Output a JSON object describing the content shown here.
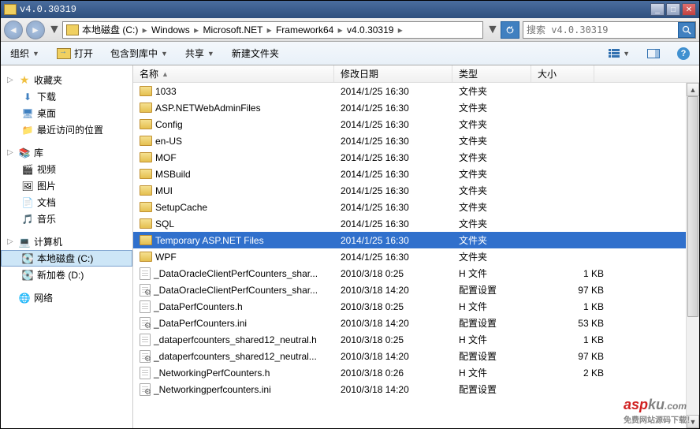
{
  "title": "v4.0.30319",
  "breadcrumb": [
    "本地磁盘 (C:)",
    "Windows",
    "Microsoft.NET",
    "Framework64",
    "v4.0.30319"
  ],
  "search_placeholder": "搜索 v4.0.30319",
  "toolbar": {
    "org": "组织",
    "open": "打开",
    "include": "包含到库中",
    "share": "共享",
    "newfolder": "新建文件夹"
  },
  "sidebar": {
    "favorites": {
      "label": "收藏夹",
      "items": [
        "下载",
        "桌面",
        "最近访问的位置"
      ]
    },
    "library": {
      "label": "库",
      "items": [
        "视频",
        "图片",
        "文档",
        "音乐"
      ]
    },
    "computer": {
      "label": "计算机",
      "items": [
        "本地磁盘 (C:)",
        "新加卷 (D:)"
      ]
    },
    "network": {
      "label": "网络"
    }
  },
  "columns": {
    "name": "名称",
    "date": "修改日期",
    "type": "类型",
    "size": "大小"
  },
  "selected_index": 9,
  "files": [
    {
      "icon": "folder",
      "name": "1033",
      "date": "2014/1/25 16:30",
      "type": "文件夹",
      "size": ""
    },
    {
      "icon": "folder",
      "name": "ASP.NETWebAdminFiles",
      "date": "2014/1/25 16:30",
      "type": "文件夹",
      "size": ""
    },
    {
      "icon": "folder",
      "name": "Config",
      "date": "2014/1/25 16:30",
      "type": "文件夹",
      "size": ""
    },
    {
      "icon": "folder",
      "name": "en-US",
      "date": "2014/1/25 16:30",
      "type": "文件夹",
      "size": ""
    },
    {
      "icon": "folder",
      "name": "MOF",
      "date": "2014/1/25 16:30",
      "type": "文件夹",
      "size": ""
    },
    {
      "icon": "folder",
      "name": "MSBuild",
      "date": "2014/1/25 16:30",
      "type": "文件夹",
      "size": ""
    },
    {
      "icon": "folder",
      "name": "MUI",
      "date": "2014/1/25 16:30",
      "type": "文件夹",
      "size": ""
    },
    {
      "icon": "folder",
      "name": "SetupCache",
      "date": "2014/1/25 16:30",
      "type": "文件夹",
      "size": ""
    },
    {
      "icon": "folder",
      "name": "SQL",
      "date": "2014/1/25 16:30",
      "type": "文件夹",
      "size": ""
    },
    {
      "icon": "folder",
      "name": "Temporary ASP.NET Files",
      "date": "2014/1/25 16:30",
      "type": "文件夹",
      "size": ""
    },
    {
      "icon": "folder",
      "name": "WPF",
      "date": "2014/1/25 16:30",
      "type": "文件夹",
      "size": ""
    },
    {
      "icon": "file",
      "name": "_DataOracleClientPerfCounters_shar...",
      "date": "2010/3/18 0:25",
      "type": "H 文件",
      "size": "1 KB"
    },
    {
      "icon": "ini",
      "name": "_DataOracleClientPerfCounters_shar...",
      "date": "2010/3/18 14:20",
      "type": "配置设置",
      "size": "97 KB"
    },
    {
      "icon": "file",
      "name": "_DataPerfCounters.h",
      "date": "2010/3/18 0:25",
      "type": "H 文件",
      "size": "1 KB"
    },
    {
      "icon": "ini",
      "name": "_DataPerfCounters.ini",
      "date": "2010/3/18 14:20",
      "type": "配置设置",
      "size": "53 KB"
    },
    {
      "icon": "file",
      "name": "_dataperfcounters_shared12_neutral.h",
      "date": "2010/3/18 0:25",
      "type": "H 文件",
      "size": "1 KB"
    },
    {
      "icon": "ini",
      "name": "_dataperfcounters_shared12_neutral...",
      "date": "2010/3/18 14:20",
      "type": "配置设置",
      "size": "97 KB"
    },
    {
      "icon": "file",
      "name": "_NetworkingPerfCounters.h",
      "date": "2010/3/18 0:26",
      "type": "H 文件",
      "size": "2 KB"
    },
    {
      "icon": "ini",
      "name": "_Networkingperfcounters.ini",
      "date": "2010/3/18 14:20",
      "type": "配置设置",
      "size": ""
    }
  ],
  "watermark": {
    "brand1": "asp",
    "brand2": "ku",
    "tld": ".com",
    "sub": "免费网站源码下载！"
  }
}
